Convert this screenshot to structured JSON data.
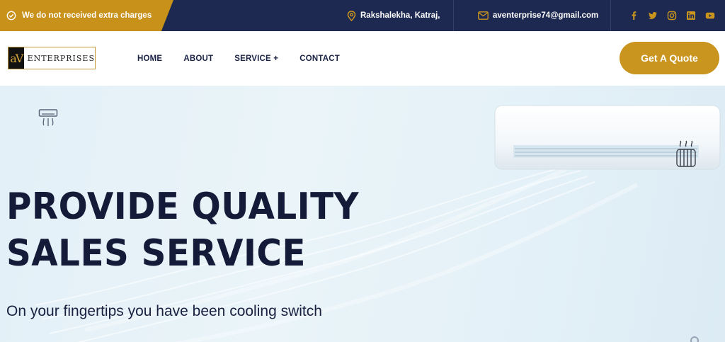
{
  "topbar": {
    "promo_text": "We do not received extra charges",
    "address": "Rakshalekha, Katraj,",
    "email": "aventerprise74@gmail.com",
    "socials": [
      "facebook-icon",
      "twitter-icon",
      "instagram-icon",
      "linkedin-icon",
      "youtube-icon"
    ]
  },
  "navbar": {
    "logo_mark": "aV",
    "logo_text": "ENTERPRISES",
    "menu": [
      "HOME",
      "ABOUT",
      "SERVICE +",
      "CONTACT"
    ],
    "cta": "Get A Quote"
  },
  "hero": {
    "title_line1": "PROVIDE QUALITY",
    "title_line2": "SALES SERVICE",
    "subtitle": "On your fingertips you have been cooling switch"
  },
  "colors": {
    "navy": "#1d2950",
    "gold": "#c9951e",
    "hero_text": "#141b38"
  }
}
